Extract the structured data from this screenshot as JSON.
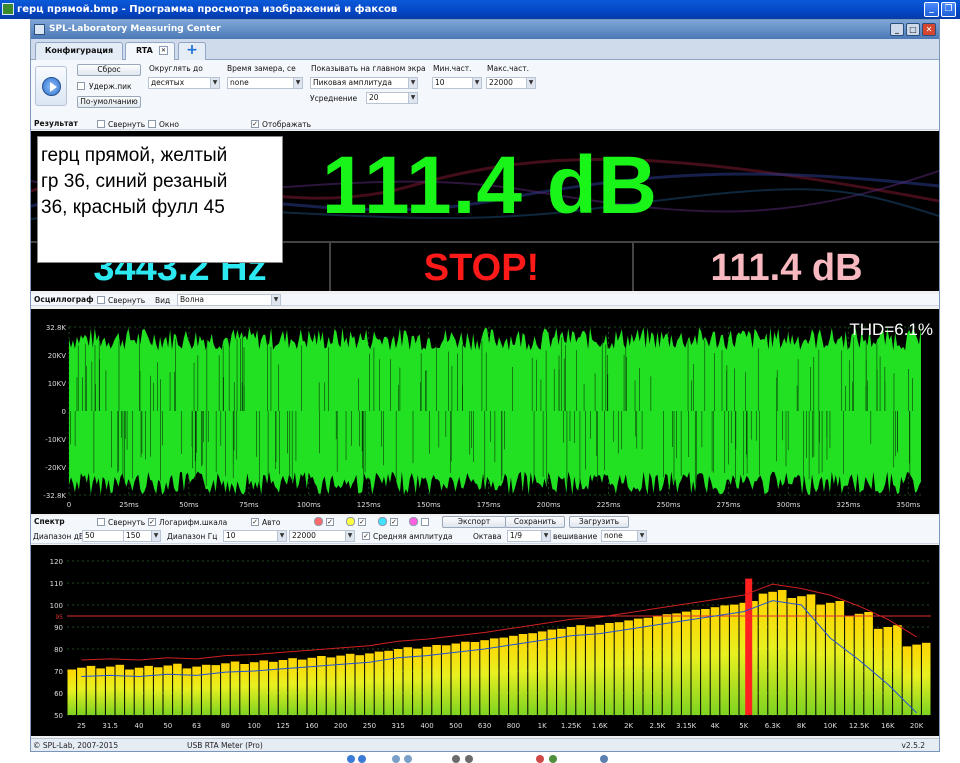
{
  "viewer": {
    "title": "герц прямой.bmp - Программа просмотра изображений и факсов"
  },
  "app": {
    "title": "SPL-Laboratory Measuring Center",
    "tabs": [
      {
        "label": "Конфигурация"
      },
      {
        "label": "RTA"
      },
      {
        "label": "+"
      }
    ]
  },
  "toolbar": {
    "reset_label": "Сброс",
    "hold_peak_label": "Удерж.пик",
    "hold_peak_checked": false,
    "default_label": "По-умолчанию",
    "round_label": "Округлять до",
    "round_value": "десятых",
    "time_label": "Время замера, се",
    "time_value": "none",
    "show_label": "Показывать на главном экра",
    "show_value": "Пиковая амплитуда",
    "averaging_label": "Усреднение",
    "averaging_value": "20",
    "min_freq_label": "Мин.част.",
    "min_freq_value": "10",
    "max_freq_label": "Макс.част.",
    "max_freq_value": "22000"
  },
  "result": {
    "title": "Результат",
    "collapse_label": "Свернуть",
    "window_label": "Окно",
    "display_label": "Отображать",
    "display_checked": true,
    "level": "111.4 dB",
    "frequency": "3443.2 Hz",
    "status": "STOP!",
    "level2": "111.4 dB",
    "note": "герц прямой, желтый\nгр 36, синий резаный\n36, красный фулл 45"
  },
  "oscillograph": {
    "title": "Осциллограф",
    "collapse_label": "Свернуть",
    "view_label": "Вид",
    "view_value": "Волна",
    "thd_text": "THD=6.1%",
    "y_ticks": [
      "32.8K",
      "20KV",
      "10KV",
      "0",
      "-10KV",
      "-20KV",
      "-32.8K"
    ],
    "x_ticks": [
      "0",
      "25ms",
      "50ms",
      "75ms",
      "100ms",
      "125ms",
      "150ms",
      "175ms",
      "200ms",
      "225ms",
      "250ms",
      "275ms",
      "300ms",
      "325ms",
      "350ms"
    ]
  },
  "spectrum": {
    "title": "Спектр",
    "collapse_label": "Свернуть",
    "log_label": "Логарифм.шкала",
    "log_checked": true,
    "auto_label": "Авто",
    "auto_checked": true,
    "export_label": "Экспорт",
    "save_label": "Сохранить",
    "load_label": "Загрузить",
    "range_db_label": "Диапазон дБ",
    "range_db_min": "50",
    "range_db_max": "150",
    "range_hz_label": "Диапазон Гц",
    "range_hz_min": "10",
    "range_hz_max": "22000",
    "avg_amp_label": "Средняя амплитуда",
    "avg_amp_checked": true,
    "octave_label": "Октава",
    "octave_value": "1/9",
    "weighting_label": "вешивание",
    "weighting_value": "none",
    "colors": [
      "#ff6b6b",
      "#ffff40",
      "#40e0ff",
      "#ff60e0"
    ],
    "marker_label": "95"
  },
  "chart_data": {
    "type": "bar",
    "y_ticks": [
      "120",
      "110",
      "100",
      "90",
      "80",
      "70",
      "60",
      "50"
    ],
    "ylim": [
      50,
      120
    ],
    "reference_line": 95,
    "x_tick_labels": [
      "25",
      "31.5",
      "40",
      "50",
      "63",
      "80",
      "100",
      "125",
      "160",
      "200",
      "250",
      "315",
      "400",
      "500",
      "630",
      "800",
      "1K",
      "1.25K",
      "1.6K",
      "2K",
      "2.5K",
      "3.15K",
      "4K",
      "5K",
      "6.3K",
      "8K",
      "10K",
      "12.5K",
      "16K",
      "20K"
    ],
    "band_values": [
      71.5,
      72,
      71.5,
      72.5,
      72,
      73.5,
      74,
      75,
      76,
      77,
      78,
      80,
      81,
      82.5,
      84,
      86,
      88,
      90,
      91,
      93,
      95,
      97,
      99,
      101,
      106,
      104,
      101,
      96,
      90,
      82
    ],
    "peak_band_index": 23,
    "peak_value": 112
  },
  "status": {
    "copyright": "© SPL-Lab, 2007-2015",
    "device": "USB RTA Meter (Pro)",
    "version": "v2.5.2"
  }
}
